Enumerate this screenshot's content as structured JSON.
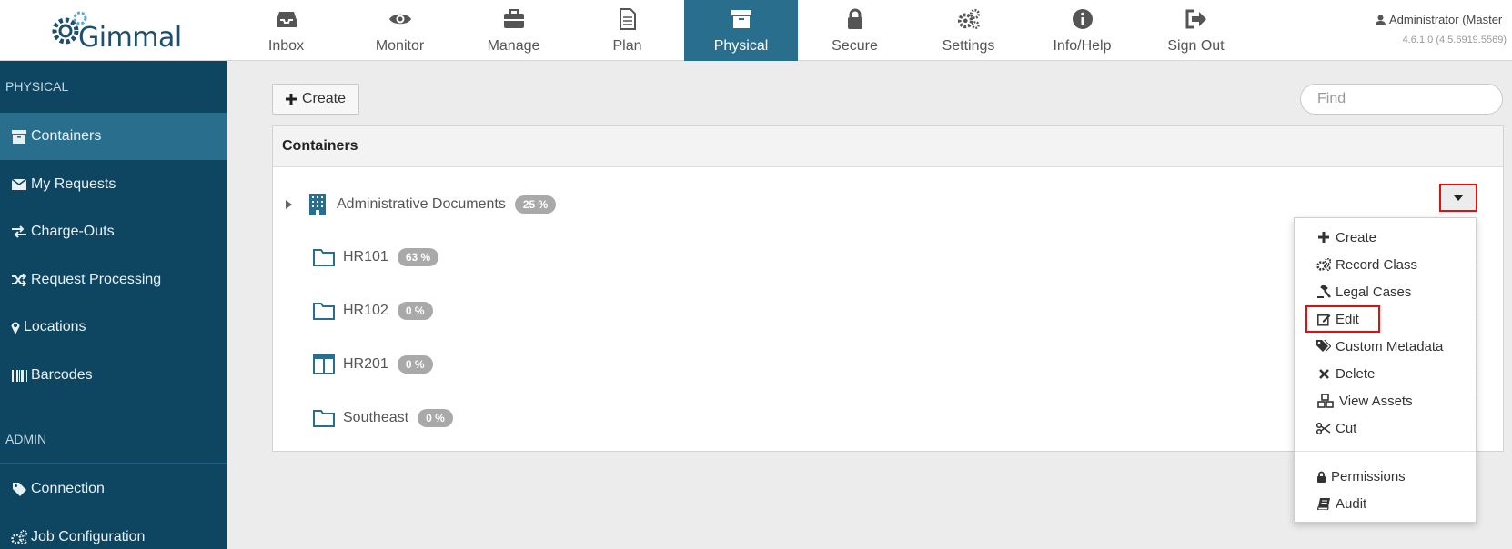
{
  "header": {
    "logo_text": "Gimmal",
    "nav": [
      {
        "label": "Inbox",
        "icon": "inbox-icon"
      },
      {
        "label": "Monitor",
        "icon": "eye-icon"
      },
      {
        "label": "Manage",
        "icon": "briefcase-icon"
      },
      {
        "label": "Plan",
        "icon": "document-icon"
      },
      {
        "label": "Physical",
        "icon": "archive-box-icon",
        "active": true
      },
      {
        "label": "Secure",
        "icon": "lock-icon"
      },
      {
        "label": "Settings",
        "icon": "gears-icon"
      },
      {
        "label": "Info/Help",
        "icon": "info-icon"
      },
      {
        "label": "Sign Out",
        "icon": "sign-out-icon"
      }
    ],
    "user": "Administrator (Master",
    "version": "4.6.1.0 (4.5.6919.5569)"
  },
  "sidebar": {
    "physical_title": "PHYSICAL",
    "admin_title": "ADMIN",
    "items": [
      {
        "label": "Containers",
        "icon": "archive-icon",
        "active": true
      },
      {
        "label": "My Requests",
        "icon": "envelope-icon"
      },
      {
        "label": "Charge-Outs",
        "icon": "exchange-icon"
      },
      {
        "label": "Request Processing",
        "icon": "shuffle-icon"
      },
      {
        "label": "Locations",
        "icon": "map-marker-icon"
      },
      {
        "label": "Barcodes",
        "icon": "barcode-icon"
      }
    ],
    "admin_items": [
      {
        "label": "Connection",
        "icon": "tag-icon"
      },
      {
        "label": "Job Configuration",
        "icon": "gears-icon"
      }
    ]
  },
  "main": {
    "create_label": "Create",
    "find_placeholder": "Find",
    "panel_title": "Containers",
    "tree": [
      {
        "label": "Administrative Documents",
        "badge": "25 %",
        "icon": "building-icon",
        "expandable": true
      },
      {
        "label": "HR101",
        "badge": "63 %",
        "icon": "folder-icon"
      },
      {
        "label": "HR102",
        "badge": "0 %",
        "icon": "folder-icon"
      },
      {
        "label": "HR201",
        "badge": "0 %",
        "icon": "columns-icon"
      },
      {
        "label": "Southeast",
        "badge": "0 %",
        "icon": "folder-icon"
      }
    ]
  },
  "menu": {
    "items": [
      {
        "label": "Create",
        "icon": "plus-icon"
      },
      {
        "label": "Record Class",
        "icon": "gears-icon"
      },
      {
        "label": "Legal Cases",
        "icon": "gavel-icon"
      },
      {
        "label": "Edit",
        "icon": "edit-icon"
      },
      {
        "label": "Custom Metadata",
        "icon": "tags-icon"
      },
      {
        "label": "Delete",
        "icon": "times-icon"
      },
      {
        "label": "View Assets",
        "icon": "cubes-icon"
      },
      {
        "label": "Cut",
        "icon": "scissors-icon"
      }
    ],
    "items2": [
      {
        "label": "Permissions",
        "icon": "lock-icon"
      },
      {
        "label": "Audit",
        "icon": "book-icon"
      }
    ]
  },
  "colors": {
    "sidebar_bg": "#0e4560",
    "active_bg": "#2a6e8d",
    "highlight_red": "#e01010",
    "icon_blue": "#2a6e8d",
    "badge_gray": "#a9a9a9"
  }
}
